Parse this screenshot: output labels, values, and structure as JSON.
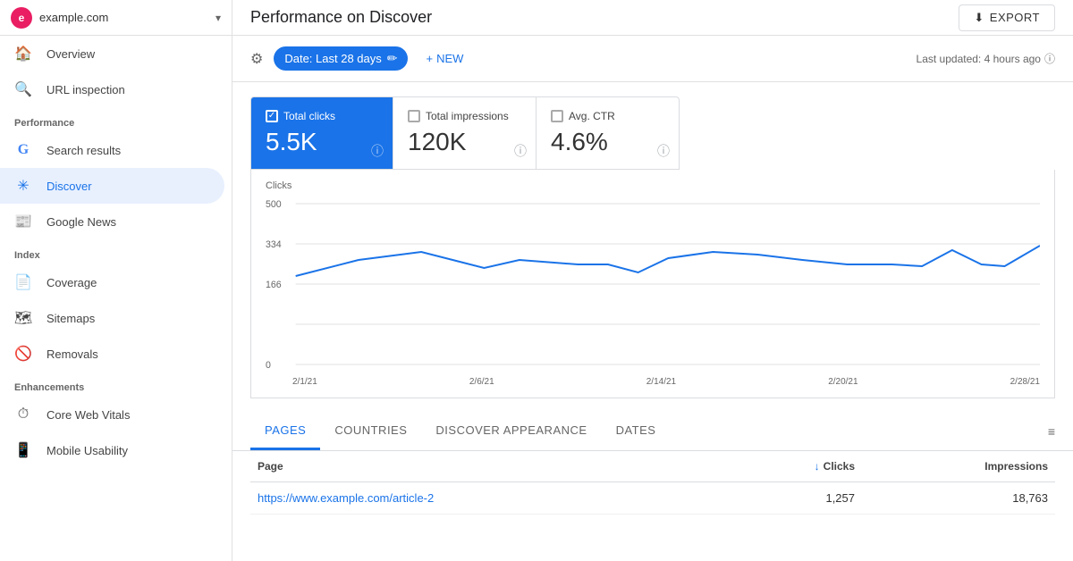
{
  "site": {
    "avatar_letter": "e",
    "name": "example.com",
    "dropdown_label": "▾"
  },
  "sidebar": {
    "nav_items": [
      {
        "id": "overview",
        "label": "Overview",
        "icon": "🏠",
        "active": false
      },
      {
        "id": "url-inspection",
        "label": "URL inspection",
        "icon": "🔍",
        "active": false
      }
    ],
    "sections": [
      {
        "label": "Performance",
        "items": [
          {
            "id": "search-results",
            "label": "Search results",
            "icon": "G",
            "icon_type": "google",
            "active": false
          },
          {
            "id": "discover",
            "label": "Discover",
            "icon": "✳",
            "active": true
          },
          {
            "id": "google-news",
            "label": "Google News",
            "icon": "▦",
            "active": false
          }
        ]
      },
      {
        "label": "Index",
        "items": [
          {
            "id": "coverage",
            "label": "Coverage",
            "icon": "📄",
            "active": false
          },
          {
            "id": "sitemaps",
            "label": "Sitemaps",
            "icon": "▦",
            "active": false
          },
          {
            "id": "removals",
            "label": "Removals",
            "icon": "⊘",
            "active": false
          }
        ]
      },
      {
        "label": "Enhancements",
        "items": [
          {
            "id": "core-web-vitals",
            "label": "Core Web Vitals",
            "icon": "⏱",
            "active": false
          },
          {
            "id": "mobile-usability",
            "label": "Mobile Usability",
            "icon": "📱",
            "active": false
          }
        ]
      }
    ]
  },
  "header": {
    "title": "Performance on Discover",
    "export_label": "EXPORT"
  },
  "filter_bar": {
    "date_chip": "Date: Last 28 days",
    "new_label": "NEW",
    "last_updated": "Last updated: 4 hours ago"
  },
  "stats": [
    {
      "id": "total-clicks",
      "label": "Total clicks",
      "value": "5.5K",
      "checked": true,
      "active": true
    },
    {
      "id": "total-impressions",
      "label": "Total impressions",
      "value": "120K",
      "checked": false,
      "active": false
    },
    {
      "id": "avg-ctr",
      "label": "Avg. CTR",
      "value": "4.6%",
      "checked": false,
      "active": false
    }
  ],
  "chart": {
    "y_label": "Clicks",
    "y_ticks": [
      "500",
      "334",
      "166",
      "0"
    ],
    "x_labels": [
      "2/1/21",
      "2/6/21",
      "2/14/21",
      "2/20/21",
      "2/28/21"
    ],
    "line_color": "#1a73e8",
    "data_points": [
      {
        "x": 0,
        "y": 0.45
      },
      {
        "x": 0.08,
        "y": 0.55
      },
      {
        "x": 0.16,
        "y": 0.62
      },
      {
        "x": 0.24,
        "y": 0.48
      },
      {
        "x": 0.3,
        "y": 0.55
      },
      {
        "x": 0.38,
        "y": 0.52
      },
      {
        "x": 0.44,
        "y": 0.52
      },
      {
        "x": 0.5,
        "y": 0.42
      },
      {
        "x": 0.55,
        "y": 0.57
      },
      {
        "x": 0.6,
        "y": 0.62
      },
      {
        "x": 0.65,
        "y": 0.6
      },
      {
        "x": 0.7,
        "y": 0.55
      },
      {
        "x": 0.75,
        "y": 0.52
      },
      {
        "x": 0.8,
        "y": 0.52
      },
      {
        "x": 0.85,
        "y": 0.5
      },
      {
        "x": 0.88,
        "y": 0.65
      },
      {
        "x": 0.92,
        "y": 0.52
      },
      {
        "x": 0.95,
        "y": 0.5
      },
      {
        "x": 1.0,
        "y": 0.68
      }
    ]
  },
  "tabs": [
    {
      "id": "pages",
      "label": "PAGES",
      "active": true
    },
    {
      "id": "countries",
      "label": "COUNTRIES",
      "active": false
    },
    {
      "id": "discover-appearance",
      "label": "DISCOVER APPEARANCE",
      "active": false
    },
    {
      "id": "dates",
      "label": "DATES",
      "active": false
    }
  ],
  "table": {
    "columns": [
      {
        "id": "page",
        "label": "Page",
        "align": "left"
      },
      {
        "id": "clicks",
        "label": "Clicks",
        "align": "right",
        "sorted": true
      },
      {
        "id": "impressions",
        "label": "Impressions",
        "align": "right"
      }
    ],
    "rows": [
      {
        "page": "https://www.example.com/article-2",
        "clicks": "1,257",
        "impressions": "18,763"
      }
    ]
  }
}
